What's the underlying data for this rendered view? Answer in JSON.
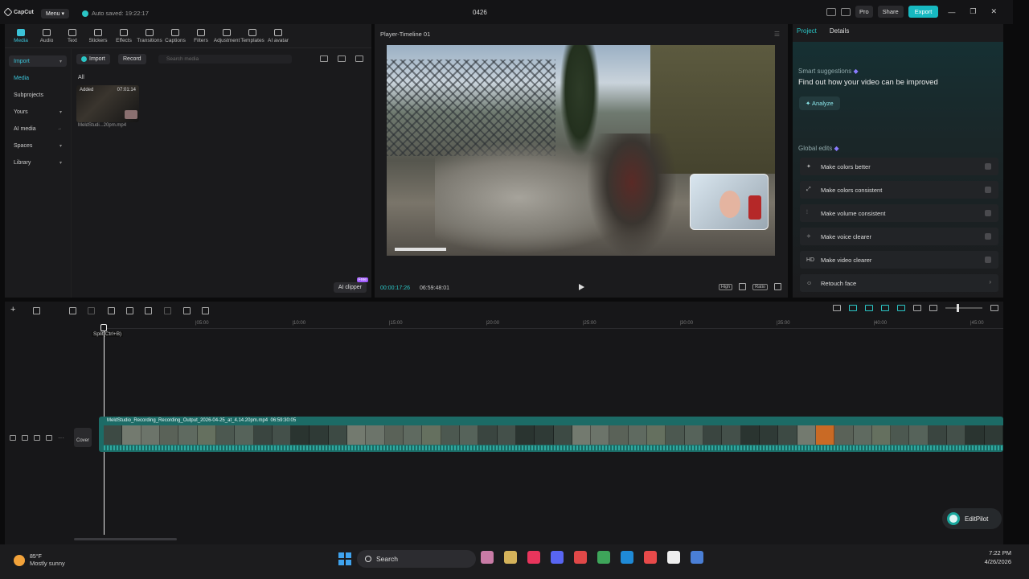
{
  "app": {
    "logo_text": "CapCut",
    "menu_label": "Menu",
    "autosave": "Auto saved: 19:22:17",
    "project_name": "0426",
    "pro_label": "Pro",
    "share_label": "Share",
    "export_label": "Export",
    "accent_color": "#17b9c1"
  },
  "toolbar": {
    "tools": [
      {
        "label": "Media",
        "icon": "media-icon"
      },
      {
        "label": "Audio",
        "icon": "audio-icon"
      },
      {
        "label": "Text",
        "icon": "text-icon"
      },
      {
        "label": "Stickers",
        "icon": "sticker-icon"
      },
      {
        "label": "Effects",
        "icon": "effects-icon"
      },
      {
        "label": "Transitions",
        "icon": "transitions-icon"
      },
      {
        "label": "Captions",
        "icon": "captions-icon"
      },
      {
        "label": "Filters",
        "icon": "filters-icon"
      },
      {
        "label": "Adjustment",
        "icon": "adjustment-icon"
      },
      {
        "label": "Templates",
        "icon": "templates-icon"
      },
      {
        "label": "AI avatar",
        "icon": "ai-avatar-icon"
      }
    ]
  },
  "sidebar": {
    "items": [
      {
        "label": "Import"
      },
      {
        "label": "Media"
      },
      {
        "label": "Subprojects"
      },
      {
        "label": "Yours"
      },
      {
        "label": "AI media"
      },
      {
        "label": "Spaces"
      },
      {
        "label": "Library"
      }
    ]
  },
  "media": {
    "import_label": "Import",
    "record_label": "Record",
    "search_placeholder": "Search media",
    "filter_label": "All",
    "thumb_added": "Added",
    "thumb_duration": "07:01:14",
    "thumb_name": "MeldStudi...20pm.mp4",
    "ai_clipper_label": "AI clipper",
    "ai_clipper_badge": "Free"
  },
  "player": {
    "title": "Player-Timeline 01",
    "current_time": "00:00:17:26",
    "total_time": "06:59:48:01",
    "quality_label": "High",
    "ratio_label": "Ratio"
  },
  "right_panel": {
    "tabs": [
      "Project",
      "Details"
    ],
    "smart_suggestions_label": "Smart suggestions",
    "smart_suggestions_title": "Find out how your video can be improved",
    "analyze_label": "Analyze",
    "global_edits_label": "Global edits",
    "edits": [
      {
        "label": "Make colors better",
        "icon": "color-wand-icon",
        "glyph": "✦"
      },
      {
        "label": "Make colors consistent",
        "icon": "color-consistent-icon",
        "glyph": "⤢"
      },
      {
        "label": "Make volume consistent",
        "icon": "volume-bars-icon",
        "glyph": "⫶"
      },
      {
        "label": "Make voice clearer",
        "icon": "voice-sparkle-icon",
        "glyph": "✧"
      },
      {
        "label": "Make video clearer",
        "icon": "hd-icon",
        "glyph": "HD"
      },
      {
        "label": "Retouch face",
        "icon": "retouch-face-icon",
        "glyph": "☺"
      }
    ]
  },
  "timeline": {
    "split_tooltip": "Split(Ctrl+B)",
    "ruler_ticks": [
      "|05:00",
      "|10:00",
      "|15:00",
      "|20:00",
      "|25:00",
      "|30:00",
      "|35:00",
      "|40:00",
      "|45:00"
    ],
    "clip_label": "MeldStudio_Recording_Recording_Output_2026-04-25_at_4.14.20pm.mp4",
    "clip_duration": "06:59:30:05",
    "cover_label": "Cover",
    "editpilot_label": "EditPilot",
    "clip_color": "#1c6b66"
  },
  "taskbar": {
    "temperature": "85°F",
    "weather": "Mostly sunny",
    "search_label": "Search",
    "time": "7:22 PM",
    "date": "4/26/2026",
    "apps": [
      {
        "name": "copilot-icon",
        "color": "#c97ba6"
      },
      {
        "name": "file-explorer-icon",
        "color": "#d4b25a"
      },
      {
        "name": "tiktok-icon",
        "color": "#e8355c"
      },
      {
        "name": "discord-icon",
        "color": "#5865f2"
      },
      {
        "name": "xmind-icon",
        "color": "#e04848"
      },
      {
        "name": "chrome-icon",
        "color": "#3ea55a"
      },
      {
        "name": "edge-icon",
        "color": "#1f8ad6"
      },
      {
        "name": "maps-icon",
        "color": "#e84a4a"
      },
      {
        "name": "capcut-icon",
        "color": "#eeeeee"
      },
      {
        "name": "meld-icon",
        "color": "#4a7fd6"
      }
    ]
  }
}
